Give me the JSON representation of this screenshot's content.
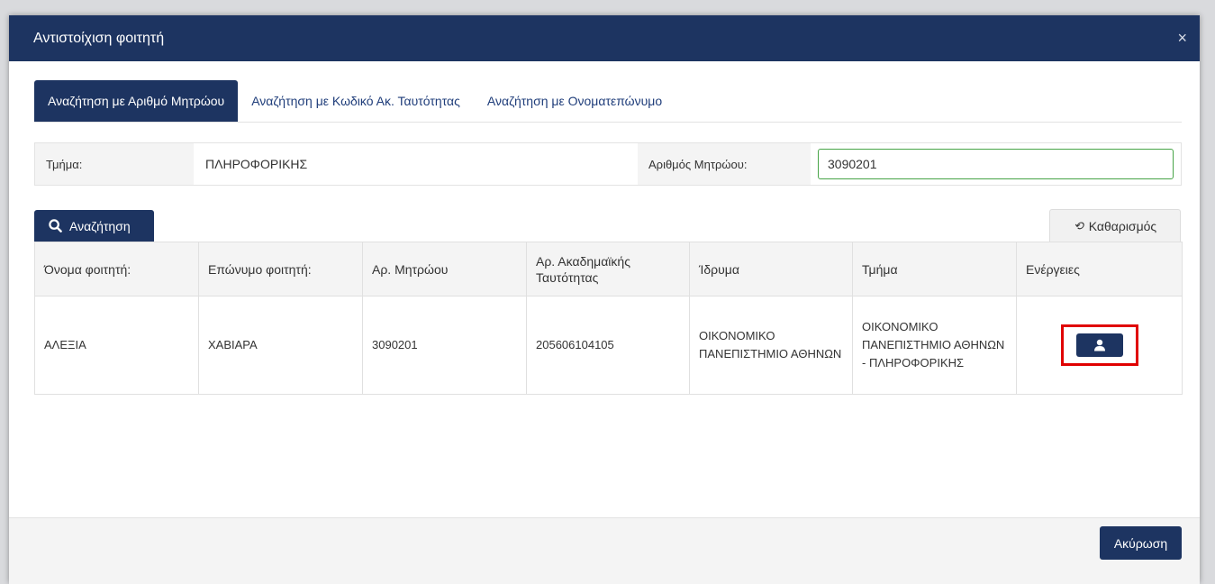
{
  "modal": {
    "title": "Αντιστοίχιση φοιτητή",
    "close_label": "×"
  },
  "tabs": [
    {
      "label": "Αναζήτηση με Αριθμό Μητρώου",
      "active": true
    },
    {
      "label": "Αναζήτηση με Κωδικό Ακ. Ταυτότητας",
      "active": false
    },
    {
      "label": "Αναζήτηση με Ονοματεπώνυμο",
      "active": false
    }
  ],
  "form": {
    "department_label": "Τμήμα:",
    "department_value": "ΠΛΗΡΟΦΟΡΙΚΗΣ",
    "registry_label": "Αριθμός Μητρώου:",
    "registry_value": "3090201"
  },
  "buttons": {
    "search": "Αναζήτηση",
    "clear": "Καθαρισμός",
    "cancel": "Ακύρωση"
  },
  "table": {
    "headers": [
      "Όνομα φοιτητή:",
      "Επώνυμο φοιτητή:",
      "Αρ. Μητρώου",
      "Αρ. Ακαδημαϊκής Ταυτότητας",
      "Ίδρυμα",
      "Τμήμα",
      "Ενέργειες"
    ],
    "rows": [
      {
        "first_name": "ΑΛΕΞΙΑ",
        "last_name": "ΧΑΒΙΑΡΑ",
        "registry": "3090201",
        "academic_id": "205606104105",
        "institution": "ΟΙΚΟΝΟΜΙΚΟ ΠΑΝΕΠΙΣΤΗΜΙΟ ΑΘΗΝΩΝ",
        "department": "ΟΙΚΟΝΟΜΙΚΟ ΠΑΝΕΠΙΣΤΗΜΙΟ ΑΘΗΝΩΝ - ΠΛΗΡΟΦΟΡΙΚΗΣ",
        "action_icon": "user-icon"
      }
    ]
  },
  "colors": {
    "primary": "#1d3461",
    "input_border": "#47a447",
    "highlight": "#e00000"
  }
}
